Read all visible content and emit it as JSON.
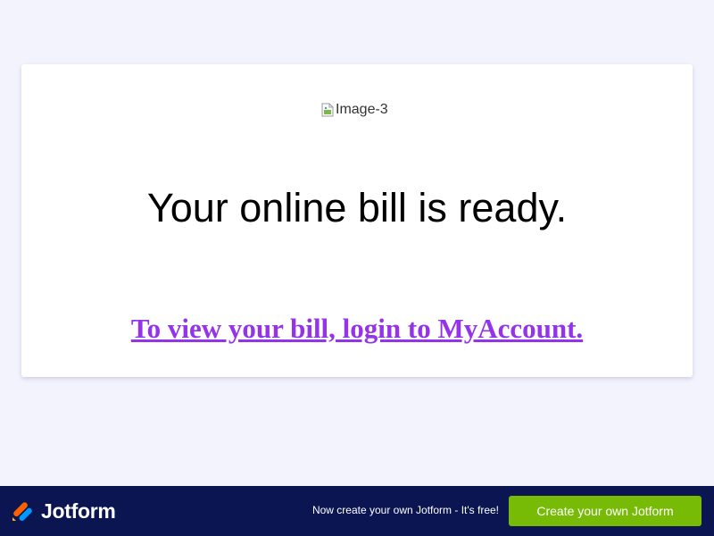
{
  "card": {
    "image_alt": "Image-3",
    "headline": "Your online bill is ready.",
    "login_link": "To view your bill, login to MyAccount."
  },
  "footer": {
    "brand_name": "Jotform",
    "promo_text": "Now create your own Jotform - It's free!",
    "cta_label": "Create your own Jotform"
  },
  "colors": {
    "page_background": "#f3f3fe",
    "link": "#9433ea",
    "footer_background": "#0a1551",
    "cta_background": "#78bb07",
    "logo_orange": "#ff6100",
    "logo_blue": "#0099ff",
    "logo_yellow": "#ffb629"
  },
  "icons": {
    "broken_image": "broken-image-icon",
    "brand_logo": "jotform-logo-icon"
  }
}
